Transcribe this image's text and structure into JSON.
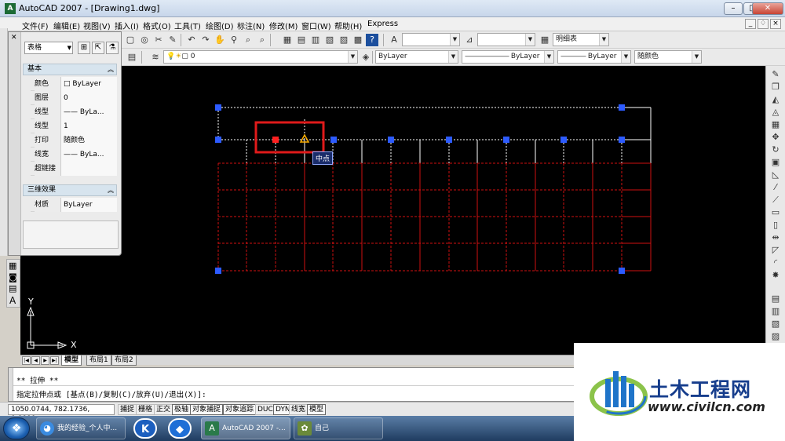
{
  "window": {
    "title": "AutoCAD 2007 - [Drawing1.dwg]",
    "min": "–",
    "max": "□",
    "close": "✕"
  },
  "doc_controls": [
    "_",
    "♢",
    "×"
  ],
  "menu": [
    "文件(F)",
    "编辑(E)",
    "视图(V)",
    "插入(I)",
    "格式(O)",
    "工具(T)",
    "绘图(D)",
    "标注(N)",
    "修改(M)",
    "窗口(W)",
    "帮助(H)",
    "Express"
  ],
  "toolbar": {
    "table_style_value": "明细表",
    "layer_value": "0",
    "color_value": "ByLayer",
    "linetype_value": "ByLayer",
    "lineweight_value": "ByLayer",
    "plotstyle_value": "随颜色"
  },
  "properties": {
    "object_type": "表格",
    "sections": {
      "basic": "基本",
      "three_d": "三维效果"
    },
    "rows": [
      {
        "key": "颜色",
        "value": "□ ByLayer"
      },
      {
        "key": "图层",
        "value": "0"
      },
      {
        "key": "线型",
        "value": "—— ByLa..."
      },
      {
        "key": "线型比...",
        "value": "1"
      },
      {
        "key": "打印样...",
        "value": "随颜色"
      },
      {
        "key": "线宽",
        "value": "—— ByLa..."
      },
      {
        "key": "超链接",
        "value": ""
      }
    ],
    "material_key": "材质",
    "material_value": "ByLayer"
  },
  "drawing": {
    "osnap_tooltip": "中点",
    "ucs_x": "X",
    "ucs_y": "Y",
    "grip_color": "#2d5bff",
    "hot_grip_color": "#ff2020",
    "table_color": "#d01010",
    "highlight_box_color": "#e01a1a"
  },
  "layout_tabs": [
    "模型",
    "布局1",
    "布局2"
  ],
  "command": {
    "line1": "** 拉伸 **",
    "line2": "指定拉伸点或 [基点(B)/复制(C)/放弃(U)/退出(X)]:"
  },
  "status": {
    "coords": "1050.0744, 782.1736, 0.0000",
    "toggles": [
      "捕捉",
      "栅格",
      "正交",
      "极轴",
      "对象捕捉",
      "对象追踪",
      "DUCS",
      "DYN",
      "线宽",
      "模型"
    ]
  },
  "taskbar": {
    "items": [
      "我的经验_个人中...",
      "AutoCAD 2007 -...",
      "自己"
    ]
  },
  "watermark": {
    "title": "土木工程网",
    "url": "www.civilcn.com"
  }
}
